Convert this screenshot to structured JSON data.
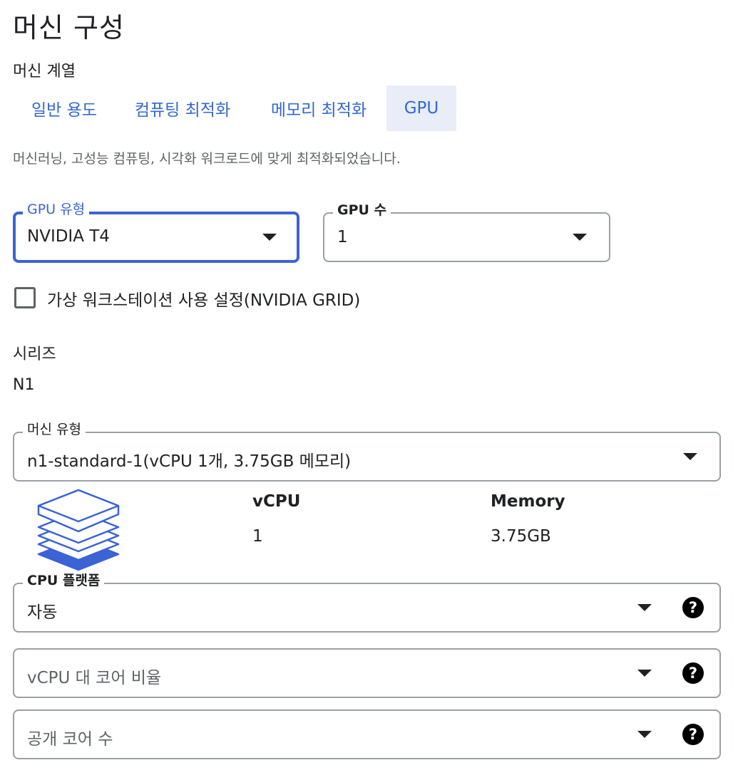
{
  "page": {
    "title": "머신 구성"
  },
  "machine_family": {
    "label": "머신 계열",
    "tabs": [
      {
        "label": "일반 용도",
        "active": false
      },
      {
        "label": "컴퓨팅 최적화",
        "active": false
      },
      {
        "label": "메모리 최적화",
        "active": false
      },
      {
        "label": "GPU",
        "active": true
      }
    ],
    "description": "머신러닝, 고성능 컴퓨팅, 시각화 워크로드에 맞게 최적화되었습니다."
  },
  "gpu": {
    "type_label": "GPU 유형",
    "type_value": "NVIDIA T4",
    "count_label": "GPU 수",
    "count_value": "1",
    "virtual_ws_label": "가상 워크스테이션 사용 설정(NVIDIA GRID)",
    "virtual_ws_checked": false
  },
  "series": {
    "label": "시리즈",
    "value": "N1"
  },
  "machine_type": {
    "label": "머신 유형",
    "value": "n1-standard-1(vCPU 1개, 3.75GB 메모리)",
    "icon": "stacked-layers-icon",
    "specs": {
      "vcpu_label": "vCPU",
      "vcpu_value": "1",
      "memory_label": "Memory",
      "memory_value": "3.75GB"
    }
  },
  "cpu_platform": {
    "label": "CPU 플랫폼",
    "value": "자동"
  },
  "vcpu_ratio": {
    "placeholder": "vCPU 대 코어 비율"
  },
  "visible_cores": {
    "placeholder": "공개 코어 수"
  },
  "help_glyph": "?",
  "colors": {
    "accent": "#3b63d6",
    "tab_active_bg": "#e8edf7",
    "border": "#9aa0a6"
  }
}
